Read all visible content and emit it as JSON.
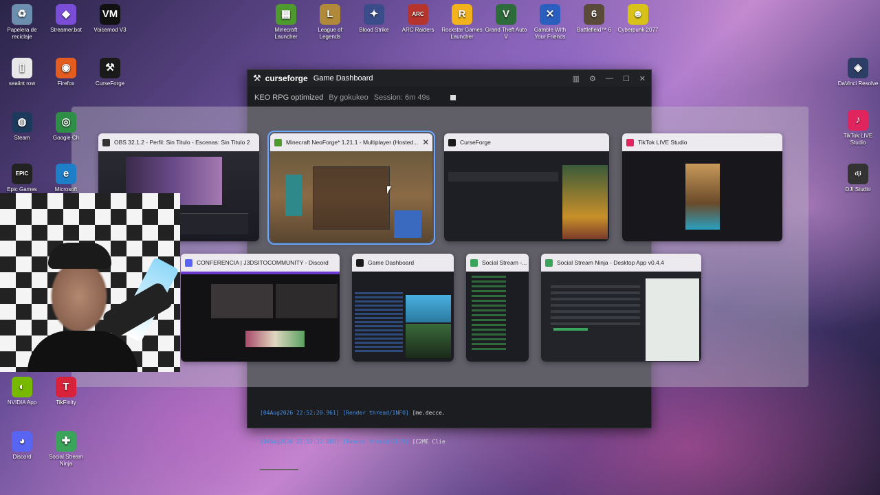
{
  "desktop": {
    "top_row": [
      {
        "label": "Papelera de reciclaje",
        "icon": "recycle-bin-icon",
        "color": "#6c8fb0",
        "glyph": "♻"
      },
      {
        "label": "Streamer.bot",
        "icon": "streamerbot-icon",
        "color": "#7a4dd6",
        "glyph": "◆"
      },
      {
        "label": "Voicemod V3",
        "icon": "voicemod-icon",
        "color": "#111111",
        "glyph": "VM"
      },
      {
        "label": "Minecraft Launcher",
        "icon": "minecraft-icon",
        "color": "#4f9a2e",
        "glyph": "▦"
      },
      {
        "label": "League of Legends",
        "icon": "league-icon",
        "color": "#b08a3a",
        "glyph": "L"
      },
      {
        "label": "Blood Strike",
        "icon": "bloodstrike-icon",
        "color": "#3a4d8a",
        "glyph": "✦"
      },
      {
        "label": "ARC Raiders",
        "icon": "arc-raiders-icon",
        "color": "#b5342c",
        "glyph": "ARC"
      },
      {
        "label": "Rockstar Games Launcher",
        "icon": "rockstar-icon",
        "color": "#f2b21b",
        "glyph": "R"
      },
      {
        "label": "Grand Theft Auto V",
        "icon": "gta-icon",
        "color": "#2d6b3a",
        "glyph": "V"
      },
      {
        "label": "Gamble With Your Friends",
        "icon": "gamble-icon",
        "color": "#2a5fbf",
        "glyph": "✕"
      },
      {
        "label": "Battlefield™ 6",
        "icon": "battlefield-icon",
        "color": "#5a4a3a",
        "glyph": "6"
      },
      {
        "label": "Cyberpunk 2077",
        "icon": "cyberpunk-icon",
        "color": "#d8c21a",
        "glyph": "☻"
      }
    ],
    "left_col": [
      {
        "label": "seaiint row",
        "icon": "text-file-icon",
        "color": "#e8e8e8",
        "glyph": "▯"
      },
      {
        "label": "Firefox",
        "icon": "firefox-icon",
        "color": "#e35d20",
        "glyph": "◉"
      },
      {
        "label": "CurseForge",
        "icon": "curseforge-icon",
        "color": "#1a1a1a",
        "glyph": "⚒"
      },
      {
        "label": "Steam",
        "icon": "steam-icon",
        "color": "#1b3a5c",
        "glyph": "◍"
      },
      {
        "label": "Google Ch",
        "icon": "chrome-icon",
        "color": "#2f8e46",
        "glyph": "◎"
      },
      {
        "label": "Epic Games",
        "icon": "epic-icon",
        "color": "#222222",
        "glyph": "EPIC"
      },
      {
        "label": "Microsoft",
        "icon": "edge-icon",
        "color": "#1f7ec8",
        "glyph": "e"
      },
      {
        "label": "NVIDIA App",
        "icon": "nvidia-icon",
        "color": "#76b900",
        "glyph": "◐"
      },
      {
        "label": "TikFinity",
        "icon": "tikfinity-icon",
        "color": "#d8223a",
        "glyph": "T"
      },
      {
        "label": "Discord",
        "icon": "discord-icon",
        "color": "#5865f2",
        "glyph": "◕"
      },
      {
        "label": "Social Stream Ninja",
        "icon": "social-stream-icon",
        "color": "#3aa55a",
        "glyph": "✚"
      }
    ],
    "right_col": [
      {
        "label": "DaVinci Resolve",
        "icon": "davinci-icon",
        "color": "#2c3e66",
        "glyph": "◈"
      },
      {
        "label": "TikTok LIVE Studio",
        "icon": "tiktok-icon",
        "color": "#e0245e",
        "glyph": "♪"
      },
      {
        "label": "DJI Studio",
        "icon": "dji-icon",
        "color": "#333333",
        "glyph": "dji"
      }
    ]
  },
  "curseforge_window": {
    "app_name": "curseforge",
    "title": "Game Dashboard",
    "profile": "KEO RPG optimized",
    "author": "By gokukeo",
    "session": "Session: 6m 49s",
    "console_lines": [
      {
        "prefix": "[04Aug2026 22:52:20.961] [Render thread/INFO] ",
        "text": "[me.decce."
      },
      {
        "prefix": "[04Aug2026 22:52:32.880] [Render thread/INFO] ",
        "text": "[C2ME Clie"
      }
    ]
  },
  "task_view": {
    "windows": [
      {
        "title": "OBS 32.1.2 - Perfil: Sin Titulo - Escenas: Sin Titulo 2",
        "icon": "obs-icon",
        "icon_color": "#333333",
        "selected": false
      },
      {
        "title": "Minecraft NeoForge* 1.21.1 - Multiplayer (Hosted...",
        "icon": "minecraft-icon",
        "icon_color": "#4f9a2e",
        "selected": true
      },
      {
        "title": "CurseForge",
        "icon": "curseforge-icon",
        "icon_color": "#1a1a1a",
        "selected": false
      },
      {
        "title": "TikTok LIVE Studio",
        "icon": "tiktok-icon",
        "icon_color": "#e0245e",
        "selected": false
      },
      {
        "title": "CONFERENCIA | J3DSITOCOMMUNITY - Discord",
        "icon": "discord-icon",
        "icon_color": "#5865f2",
        "selected": false
      },
      {
        "title": "Game Dashboard",
        "icon": "curseforge-icon",
        "icon_color": "#1a1a1a",
        "selected": false
      },
      {
        "title": "Social Stream -...",
        "icon": "social-stream-icon",
        "icon_color": "#3aa55a",
        "selected": false
      },
      {
        "title": "Social Stream Ninja - Desktop App v0.4.4",
        "icon": "social-stream-icon",
        "icon_color": "#3aa55a",
        "selected": false
      }
    ],
    "close_glyph": "✕"
  }
}
